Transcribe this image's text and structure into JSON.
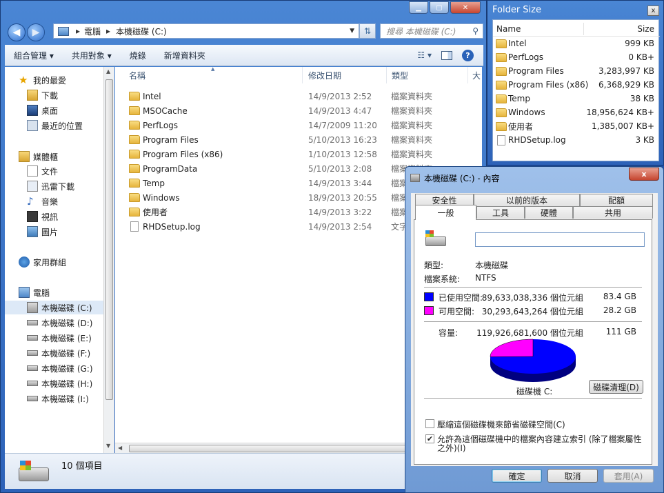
{
  "explorer": {
    "address": {
      "computer": "電腦",
      "drive": "本機磁碟 (C:)"
    },
    "search_placeholder": "搜尋 本機磁碟 (C:)",
    "toolbar": [
      "組合管理",
      "共用對象",
      "燒錄",
      "新增資料夾"
    ],
    "nav": {
      "favorites": "我的最愛",
      "fav_items": [
        "下載",
        "桌面",
        "最近的位置"
      ],
      "libraries": "媒體櫃",
      "lib_items": [
        "文件",
        "迅雷下載",
        "音樂",
        "視訊",
        "圖片"
      ],
      "homegroup": "家用群組",
      "computer": "電腦",
      "drives": [
        "本機磁碟 (C:)",
        "本機磁碟 (D:)",
        "本機磁碟 (E:)",
        "本機磁碟 (F:)",
        "本機磁碟 (G:)",
        "本機磁碟 (H:)",
        "本機磁碟 (I:)"
      ]
    },
    "columns": {
      "name": "名稱",
      "date": "修改日期",
      "type": "類型",
      "size": "大"
    },
    "files": [
      {
        "name": "Intel",
        "date": "14/9/2013 2:52",
        "type": "檔案資料夾",
        "kind": "folder"
      },
      {
        "name": "MSOCache",
        "date": "14/9/2013 4:47",
        "type": "檔案資料夾",
        "kind": "folder"
      },
      {
        "name": "PerfLogs",
        "date": "14/7/2009 11:20",
        "type": "檔案資料夾",
        "kind": "folder"
      },
      {
        "name": "Program Files",
        "date": "5/10/2013 16:23",
        "type": "檔案資料夾",
        "kind": "folder"
      },
      {
        "name": "Program Files (x86)",
        "date": "1/10/2013 12:58",
        "type": "檔案資料夾",
        "kind": "folder"
      },
      {
        "name": "ProgramData",
        "date": "5/10/2013 2:08",
        "type": "檔案資料夾",
        "kind": "folder"
      },
      {
        "name": "Temp",
        "date": "14/9/2013 3:44",
        "type": "檔案資料夾",
        "kind": "folder"
      },
      {
        "name": "Windows",
        "date": "18/9/2013 20:55",
        "type": "檔案資料夾",
        "kind": "folder"
      },
      {
        "name": "使用者",
        "date": "14/9/2013 3:22",
        "type": "檔案資料夾",
        "kind": "folder"
      },
      {
        "name": "RHDSetup.log",
        "date": "14/9/2013 2:54",
        "type": "文字",
        "kind": "file"
      }
    ],
    "status": "10 個項目"
  },
  "folder_size": {
    "title": "Folder Size",
    "close": "x",
    "col_name": "Name",
    "col_size": "Size",
    "items": [
      {
        "name": "Intel",
        "size": "999 KB",
        "kind": "folder"
      },
      {
        "name": "PerfLogs",
        "size": "0 KB+",
        "kind": "folder"
      },
      {
        "name": "Program Files",
        "size": "3,283,997 KB",
        "kind": "folder"
      },
      {
        "name": "Program Files (x86)",
        "size": "6,368,929 KB",
        "kind": "folder"
      },
      {
        "name": "Temp",
        "size": "38 KB",
        "kind": "folder"
      },
      {
        "name": "Windows",
        "size": "18,956,624 KB+",
        "kind": "folder"
      },
      {
        "name": "使用者",
        "size": "1,385,007 KB+",
        "kind": "folder"
      },
      {
        "name": "RHDSetup.log",
        "size": "3 KB",
        "kind": "file"
      }
    ]
  },
  "props": {
    "title": "本機磁碟 (C:) - 內容",
    "close": "x",
    "tabs_back": [
      "安全性",
      "以前的版本",
      "配額"
    ],
    "tabs_front": [
      "一般",
      "工具",
      "硬體",
      "共用"
    ],
    "type_label": "類型:",
    "type_value": "本機磁碟",
    "fs_label": "檔案系統:",
    "fs_value": "NTFS",
    "used_label": "已使用空間:",
    "used_bytes": "89,633,038,336 個位元組",
    "used_gb": "83.4 GB",
    "free_label": "可用空間:",
    "free_bytes": "30,293,643,264 個位元組",
    "free_gb": "28.2 GB",
    "cap_label": "容量:",
    "cap_bytes": "119,926,681,600 個位元組",
    "cap_gb": "111 GB",
    "used_fraction": 0.747,
    "used_color": "#0000ff",
    "free_color": "#ff00ff",
    "drive_label": "磁碟機 C:",
    "cleanup": "磁碟清理(D)",
    "compress": "壓縮這個磁碟機來節省磁碟空間(C)",
    "index_line1": "允許為這個磁碟機中的檔案內容建立索引 (除了檔案屬性",
    "index_line2": "之外)(I)",
    "ok": "確定",
    "cancel": "取消",
    "apply": "套用(A)"
  }
}
